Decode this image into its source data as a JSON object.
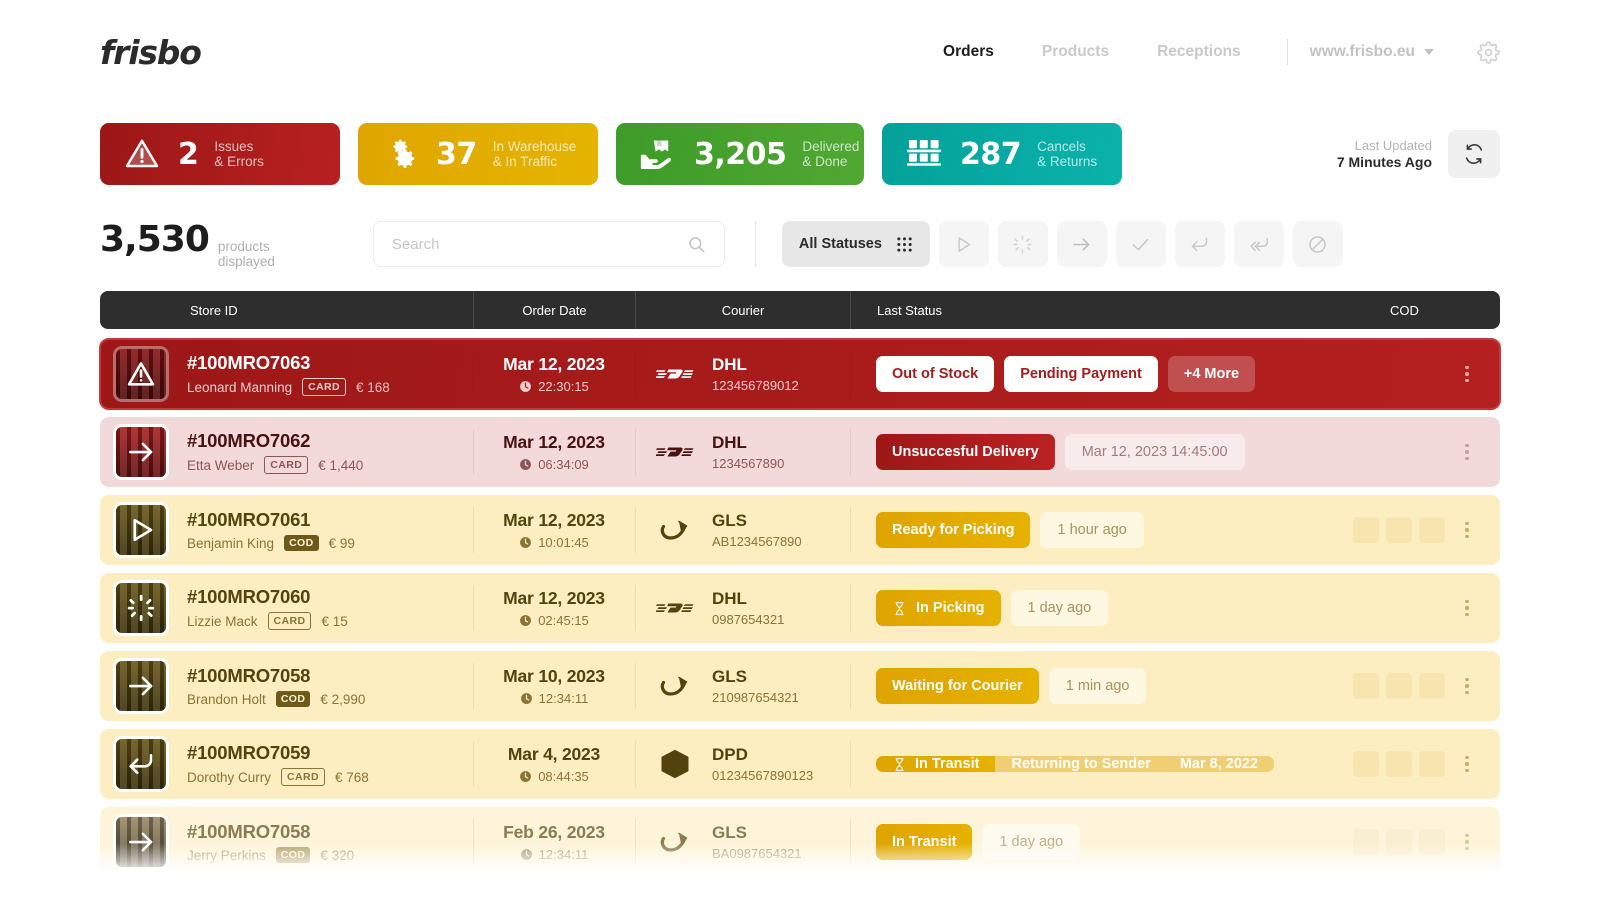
{
  "brand": {
    "logo": "frisbo"
  },
  "nav": {
    "links": [
      {
        "label": "Orders",
        "active": true
      },
      {
        "label": "Products",
        "active": false
      },
      {
        "label": "Receptions",
        "active": false
      }
    ],
    "domain": "www.frisbo.eu",
    "settings_icon": "gear-icon"
  },
  "stats": [
    {
      "icon": "warning-triangle-icon",
      "value": "2",
      "line1": "Issues",
      "line2": "& Errors",
      "color": "#b82020"
    },
    {
      "icon": "gears-icon",
      "value": "37",
      "line1": "In Warehouse",
      "line2": "& In Traffic",
      "color": "#e5b400"
    },
    {
      "icon": "hand-package-icon",
      "value": "3,205",
      "line1": "Delivered",
      "line2": "& Done",
      "color": "#51a832"
    },
    {
      "icon": "shelves-icon",
      "value": "287",
      "line1": "Cancels",
      "line2": "& Returns",
      "color": "#0bb3ab"
    }
  ],
  "updated": {
    "label": "Last Updated",
    "value": "7 Minutes Ago",
    "refresh_icon": "refresh-icon"
  },
  "toolbar": {
    "count": "3,530",
    "count_label_1": "products",
    "count_label_2": "displayed",
    "search_placeholder": "Search",
    "search_value": "",
    "search_icon": "search-icon",
    "all_statuses_label": "All Statuses",
    "grid_icon": "grid-dots-icon",
    "filter_buttons": [
      {
        "icon": "play-icon"
      },
      {
        "icon": "spinner-icon"
      },
      {
        "icon": "arrow-right-icon"
      },
      {
        "icon": "check-icon"
      },
      {
        "icon": "return-arrow-icon"
      },
      {
        "icon": "double-return-arrow-icon"
      },
      {
        "icon": "ban-icon"
      }
    ]
  },
  "table": {
    "headers": {
      "store_id": "Store ID",
      "order_date": "Order Date",
      "courier": "Courier",
      "last_status": "Last Status",
      "cod": "COD"
    },
    "rows": [
      {
        "theme": "error",
        "thumb_icon": "warning-triangle-icon",
        "order_id": "#100MRO7063",
        "customer": "Leonard Manning",
        "payment_tag": "CARD",
        "amount": "€ 168",
        "date": "Mar 12, 2023",
        "time": "22:30:15",
        "courier": "DHL",
        "courier_icon": "dhl-icon",
        "tracking": "123456789012",
        "statuses": [
          {
            "label": "Out of Stock",
            "style": "white"
          },
          {
            "label": "Pending Payment",
            "style": "white"
          },
          {
            "label": "+4 More",
            "style": "translucent"
          }
        ],
        "cod_boxes": 0
      },
      {
        "theme": "pink",
        "thumb_icon": "arrow-right-icon",
        "order_id": "#100MRO7062",
        "customer": "Etta Weber",
        "payment_tag": "CARD",
        "amount": "€ 1,440",
        "date": "Mar 12, 2023",
        "time": "06:34:09",
        "courier": "DHL",
        "courier_icon": "dhl-icon",
        "tracking": "1234567890",
        "statuses": [
          {
            "label": "Unsuccesful Delivery",
            "style": "red"
          },
          {
            "label": "Mar 12, 2023  14:45:00",
            "style": "ghost"
          }
        ],
        "cod_boxes": 0
      },
      {
        "theme": "cream",
        "thumb_icon": "play-icon",
        "order_id": "#100MRO7061",
        "customer": "Benjamin King",
        "payment_tag": "COD",
        "amount": "€ 99",
        "date": "Mar 12, 2023",
        "time": "10:01:45",
        "courier": "GLS",
        "courier_icon": "gls-icon",
        "tracking": "AB1234567890",
        "statuses": [
          {
            "label": "Ready for Picking",
            "style": "amber"
          },
          {
            "label": "1 hour ago",
            "style": "ghost"
          }
        ],
        "cod_boxes": 3
      },
      {
        "theme": "cream",
        "thumb_icon": "spinner-icon",
        "order_id": "#100MRO7060",
        "customer": "Lizzie Mack",
        "payment_tag": "CARD",
        "amount": "€ 15",
        "date": "Mar 12, 2023",
        "time": "02:45:15",
        "courier": "DHL",
        "courier_icon": "dhl-icon",
        "tracking": "0987654321",
        "statuses": [
          {
            "label": "In Picking",
            "style": "amber",
            "icon": "hourglass-icon"
          },
          {
            "label": "1 day ago",
            "style": "ghost"
          }
        ],
        "cod_boxes": 0
      },
      {
        "theme": "cream",
        "thumb_icon": "arrow-right-icon",
        "order_id": "#100MRO7058",
        "customer": "Brandon Holt",
        "payment_tag": "COD",
        "amount": "€ 2,990",
        "date": "Mar 10, 2023",
        "time": "12:34:11",
        "courier": "GLS",
        "courier_icon": "gls-icon",
        "tracking": "210987654321",
        "statuses": [
          {
            "label": "Waiting for Courier",
            "style": "amber"
          },
          {
            "label": "1 min ago",
            "style": "ghost"
          }
        ],
        "cod_boxes": 3
      },
      {
        "theme": "cream",
        "thumb_icon": "return-arrow-icon",
        "order_id": "#100MRO7059",
        "customer": "Dorothy Curry",
        "payment_tag": "CARD",
        "amount": "€ 768",
        "date": "Mar 4, 2023",
        "time": "08:44:35",
        "courier": "DPD",
        "courier_icon": "dpd-icon",
        "tracking": "01234567890123",
        "combo": {
          "primary": "In Transit",
          "primary_icon": "hourglass-icon",
          "secondary": "Returning to Sender",
          "date": "Mar 8, 2022"
        },
        "statuses": [],
        "cod_boxes": 3
      },
      {
        "theme": "cream-fade",
        "thumb_icon": "arrow-right-icon",
        "order_id": "#100MRO7058",
        "customer": "Jerry Perkins",
        "payment_tag": "COD",
        "amount": "€ 320",
        "date": "Feb 26, 2023",
        "time": "12:34:11",
        "courier": "GLS",
        "courier_icon": "gls-icon",
        "tracking": "BA0987654321",
        "statuses": [
          {
            "label": "In Transit",
            "style": "amber"
          },
          {
            "label": "1 day ago",
            "style": "ghost"
          }
        ],
        "cod_boxes": 3
      }
    ]
  }
}
